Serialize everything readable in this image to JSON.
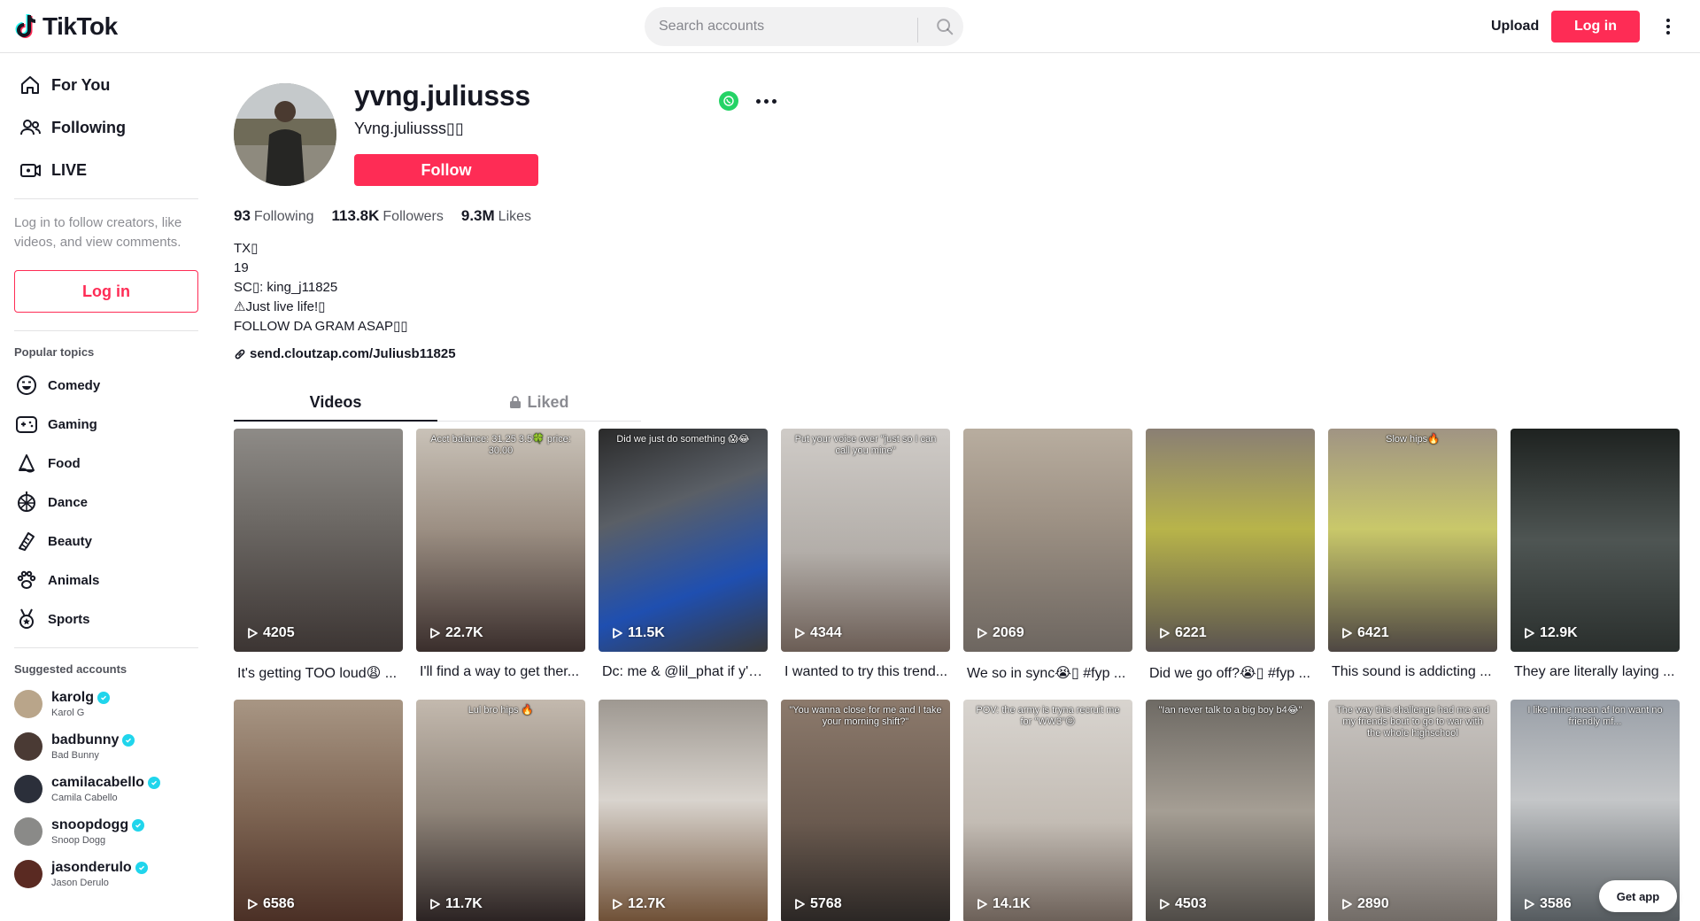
{
  "header": {
    "brand": "TikTok",
    "search_placeholder": "Search accounts",
    "upload_label": "Upload",
    "login_label": "Log in"
  },
  "sidebar": {
    "nav": [
      {
        "label": "For You",
        "icon": "home-icon"
      },
      {
        "label": "Following",
        "icon": "users-icon"
      },
      {
        "label": "LIVE",
        "icon": "live-icon"
      }
    ],
    "login_hint": "Log in to follow creators, like videos, and view comments.",
    "login_label": "Log in",
    "popular_topics_title": "Popular topics",
    "topics": [
      {
        "label": "Comedy",
        "icon": "smile-icon"
      },
      {
        "label": "Gaming",
        "icon": "gamepad-icon"
      },
      {
        "label": "Food",
        "icon": "food-icon"
      },
      {
        "label": "Dance",
        "icon": "dance-icon"
      },
      {
        "label": "Beauty",
        "icon": "beauty-icon"
      },
      {
        "label": "Animals",
        "icon": "paw-icon"
      },
      {
        "label": "Sports",
        "icon": "medal-icon"
      }
    ],
    "suggested_title": "Suggested accounts",
    "accounts": [
      {
        "username": "karolg",
        "name": "Karol G",
        "verified": true,
        "avatar_color": "#b9a58a"
      },
      {
        "username": "badbunny",
        "name": "Bad Bunny",
        "verified": true,
        "avatar_color": "#4a3a34"
      },
      {
        "username": "camilacabello",
        "name": "Camila Cabello",
        "verified": true,
        "avatar_color": "#2b2f3a"
      },
      {
        "username": "snoopdogg",
        "name": "Snoop Dogg",
        "verified": true,
        "avatar_color": "#8a8a88"
      },
      {
        "username": "jasonderulo",
        "name": "Jason Derulo",
        "verified": true,
        "avatar_color": "#5a2a22"
      }
    ]
  },
  "profile": {
    "username": "yvng.juliusss",
    "nickname": "Yvng.juliusss▯▯",
    "follow_label": "Follow",
    "stats": [
      {
        "value": "93",
        "label": "Following"
      },
      {
        "value": "113.8K",
        "label": "Followers"
      },
      {
        "value": "9.3M",
        "label": "Likes"
      }
    ],
    "bio": "TX▯\n19\nSC▯: king_j11825\n⚠Just live life!▯\nFOLLOW DA GRAM ASAP▯▯",
    "link": "send.cloutzap.com/Juliusb11825",
    "tabs": {
      "videos": "Videos",
      "liked": "Liked"
    }
  },
  "videos": [
    {
      "views": "4205",
      "desc": "It's getting TOO loud😩 ...",
      "caption": "",
      "bg": "linear-gradient(180deg,#8e8b87 0%,#6e6a66 40%,#3c3533 100%)"
    },
    {
      "views": "22.7K",
      "desc": "I'll find a way to get ther...",
      "caption": "Acct balance: 31.25\n3.5🍀 price: 30.00",
      "bg": "linear-gradient(180deg,#c9c2b8 0%,#9c8f83 45%,#3a2e2c 100%)"
    },
    {
      "views": "11.5K",
      "desc": "Dc: me & @lil_phat if y'a...",
      "caption": "Did we just do something 😱😂",
      "bg": "linear-gradient(160deg,#2a2a2a 0%,#5a5f66 35%,#1f4fb0 70%,#3a3a3a 100%)"
    },
    {
      "views": "4344",
      "desc": "I wanted to try this trend...",
      "caption": "Put your voice over \"just so I can call you mine\"",
      "bg": "linear-gradient(180deg,#cfcbc7 0%,#b3aea9 55%,#6b5d55 100%)"
    },
    {
      "views": "2069",
      "desc": "We so in sync😭▯ #fyp ...",
      "caption": "",
      "bg": "linear-gradient(180deg,#b8ad9f 0%,#9e9285 40%,#6d6660 100%)"
    },
    {
      "views": "6221",
      "desc": "Did we go off?😭▯ #fyp ...",
      "caption": "",
      "bg": "linear-gradient(180deg,#8a7f74 0%,#b8b44a 45%,#5a5350 100%)"
    },
    {
      "views": "6421",
      "desc": "This sound is addicting ...",
      "caption": "Slow hips🔥",
      "bg": "linear-gradient(180deg,#a09484 0%,#c9c86a 45%,#4e4743 100%)"
    },
    {
      "views": "12.9K",
      "desc": "They are literally laying ...",
      "caption": "",
      "bg": "linear-gradient(180deg,#1e2220 0%,#4e5553 50%,#2a2f2d 100%)"
    },
    {
      "views": "6586",
      "desc": "",
      "caption": "",
      "bg": "linear-gradient(180deg,#a89684 0%,#7e6553 50%,#4a2f25 100%)"
    },
    {
      "views": "11.7K",
      "desc": "",
      "caption": "Lul bro hips 🔥",
      "bg": "linear-gradient(180deg,#c3b9ae 0%,#8f8479 50%,#2a2222 100%)"
    },
    {
      "views": "12.7K",
      "desc": "",
      "caption": "",
      "bg": "linear-gradient(180deg,#9e9891 0%,#d9d4ce 45%,#6e4f35 100%)"
    },
    {
      "views": "5768",
      "desc": "",
      "caption": "\"You wanna close for me and I take your morning shift?\"",
      "bg": "linear-gradient(180deg,#8c7a6c 0%,#6a5a4f 55%,#2a2624 100%)"
    },
    {
      "views": "14.1K",
      "desc": "",
      "caption": "POV: the army is tryna recruit me for \"WW3\"😖",
      "bg": "linear-gradient(180deg,#d8d4cf 0%,#c3bcb4 55%,#6b5f57 100%)"
    },
    {
      "views": "4503",
      "desc": "",
      "caption": "\"Ian never talk to a big boy b4😂\"",
      "bg": "linear-gradient(180deg,#6e6a64 0%,#a59e94 50%,#4e4a46 100%)"
    },
    {
      "views": "2890",
      "desc": "",
      "caption": "The way this challenge had me and my friends bout to go to war with the whole highschool",
      "bg": "linear-gradient(180deg,#c8c4c0 0%,#a9a39e 60%,#716b66 100%)"
    },
    {
      "views": "3586",
      "desc": "",
      "caption": "I like mine mean af Ion want no friendly mf...",
      "bg": "linear-gradient(180deg,#9aa0a8 0%,#c4c6c8 45%,#545a5e 100%)"
    }
  ],
  "get_app_label": "Get app",
  "colors": {
    "accent": "#fe2c55",
    "verified": "#20d5ec",
    "whatsapp": "#25d366"
  }
}
